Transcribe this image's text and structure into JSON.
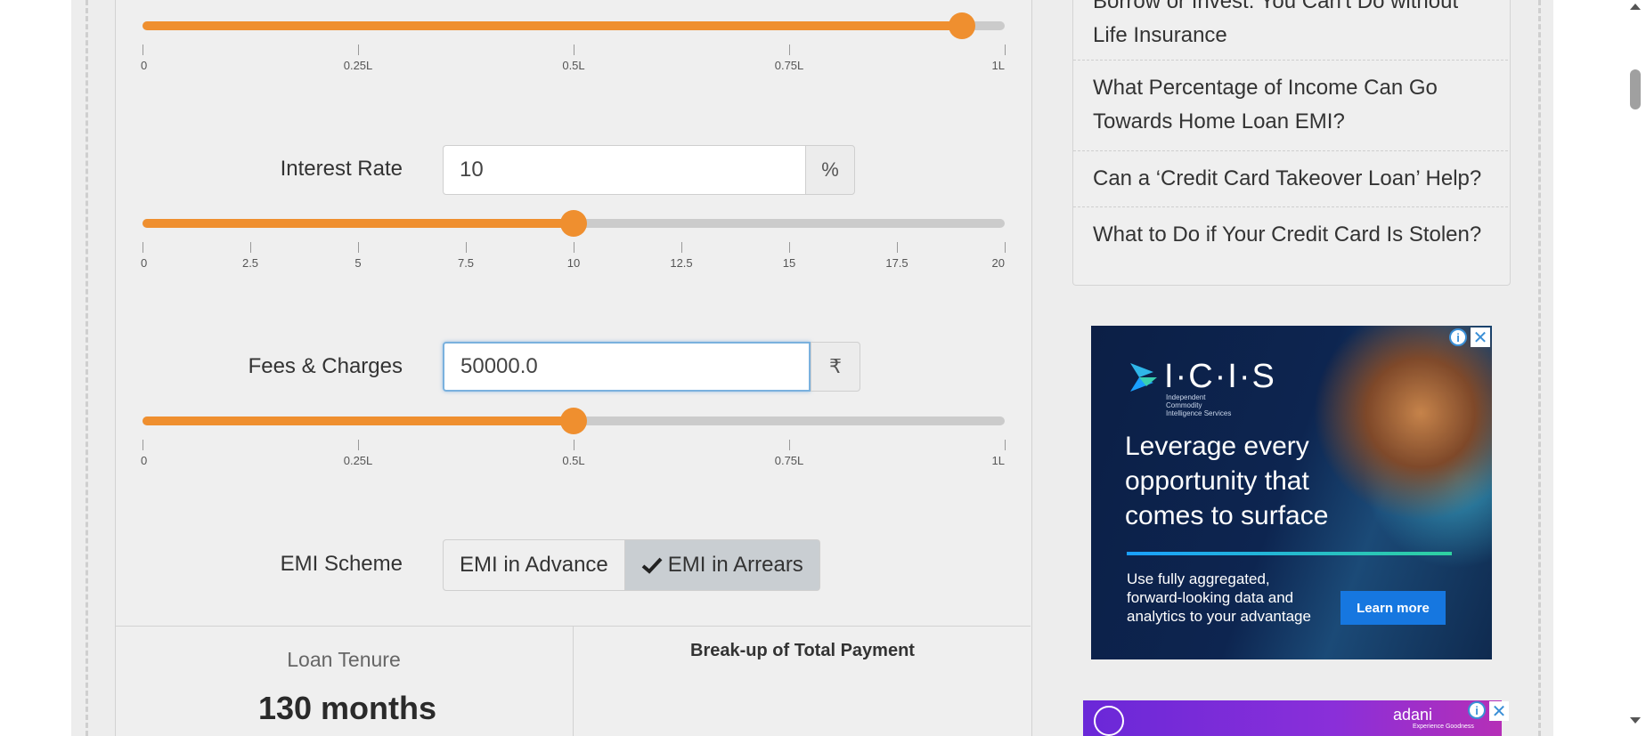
{
  "loan_amount_slider": {
    "value": 0.95,
    "ticks": [
      "0",
      "0.25L",
      "0.5L",
      "0.75L",
      "1L"
    ]
  },
  "interest_rate": {
    "label": "Interest Rate",
    "value": "10",
    "unit": "%",
    "slider_value": 10,
    "ticks": [
      "0",
      "2.5",
      "5",
      "7.5",
      "10",
      "12.5",
      "15",
      "17.5",
      "20"
    ]
  },
  "fees": {
    "label": "Fees & Charges",
    "value": "50000.0",
    "unit": "₹",
    "slider_value": 0.5,
    "ticks": [
      "0",
      "0.25L",
      "0.5L",
      "0.75L",
      "1L"
    ]
  },
  "emi_scheme": {
    "label": "EMI Scheme",
    "options": [
      "EMI in Advance",
      "EMI in Arrears"
    ],
    "selected": "EMI in Arrears"
  },
  "results": {
    "tenure_label": "Loan Tenure",
    "tenure_value": "130 months",
    "breakup_title": "Break-up of Total Payment"
  },
  "sidebar": {
    "items": [
      "Borrow or Invest: You Can't Do without Life Insurance",
      "What Percentage of Income Can Go Towards Home Loan EMI?",
      "Can a ‘Credit Card Takeover Loan’ Help?",
      "What to Do if Your Credit Card Is Stolen?"
    ]
  },
  "ad": {
    "brand": "I·C·I·S",
    "brand_sub": "Independent Commodity Intelligence Services",
    "headline": "Leverage every opportunity that comes to surface",
    "body": "Use fully aggregated, forward-looking data and analytics to your advantage",
    "cta": "Learn more",
    "info_glyph": "i",
    "close_glyph": "✕"
  },
  "ad2": {
    "brand": "adani",
    "sub": "Experience Goodness",
    "info_glyph": "i",
    "close_glyph": "✕"
  },
  "colors": {
    "accent": "#ef8f2f",
    "track": "#cbcbcb",
    "selected_button": "#c9ced2"
  }
}
